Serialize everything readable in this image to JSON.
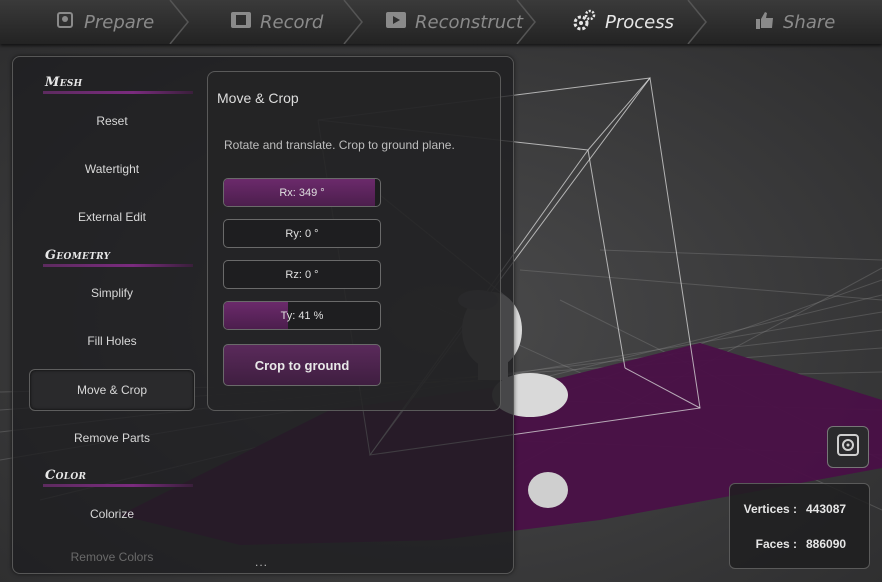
{
  "steps": [
    {
      "label": "Prepare",
      "icon": "prepare-icon",
      "active": false
    },
    {
      "label": "Record",
      "icon": "film-icon",
      "active": false
    },
    {
      "label": "Reconstruct",
      "icon": "film-frame-icon",
      "active": false
    },
    {
      "label": "Process",
      "icon": "gears-icon",
      "active": true
    },
    {
      "label": "Share",
      "icon": "thumbs-up-icon",
      "active": false
    }
  ],
  "panel": {
    "sections": [
      {
        "title": "Mesh",
        "items": [
          "Reset",
          "Watertight",
          "External Edit"
        ]
      },
      {
        "title": "Geometry",
        "items": [
          "Simplify",
          "Fill Holes",
          "Move & Crop",
          "Remove Parts"
        ]
      },
      {
        "title": "Color",
        "items": [
          "Colorize",
          "Remove Colors"
        ]
      }
    ],
    "active_item": "Move & Crop",
    "more": "..."
  },
  "subpanel": {
    "title": "Move & Crop",
    "description": "Rotate and translate. Crop to ground plane.",
    "sliders": [
      {
        "label": "Rx: 349 °",
        "value": 0.97
      },
      {
        "label": "Ry: 0 °",
        "value": 0
      },
      {
        "label": "Rz: 0 °",
        "value": 0
      },
      {
        "label": "Ty: 41 %",
        "value": 0.41
      }
    ],
    "crop_button": "Crop to ground"
  },
  "stats": {
    "vertices_label": "Vertices :",
    "vertices": "443087",
    "faces_label": "Faces :",
    "faces": "886090"
  },
  "colors": {
    "accent": "#6b2a6b",
    "ground_plane": "#4a1047"
  }
}
